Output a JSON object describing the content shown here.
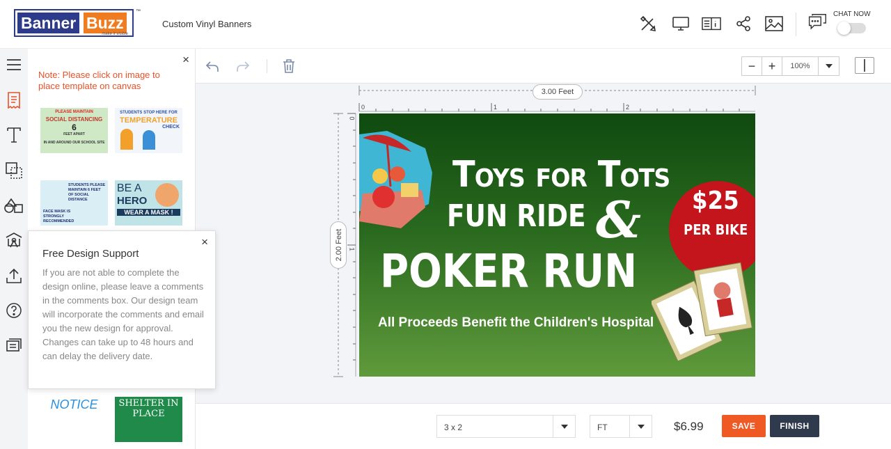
{
  "header": {
    "logo_part1": "Banner",
    "logo_part2": "Buzz",
    "logo_tag": "make it visible",
    "logo_tm": "™",
    "product_name": "Custom Vinyl Banners",
    "icons": [
      "tools-icon",
      "desktop-preview-icon",
      "info-book-icon",
      "share-icon",
      "image-icon",
      "chat-icon"
    ],
    "chat_label": "CHAT NOW"
  },
  "sidebar": {
    "icons": [
      "menu-icon",
      "templates-icon",
      "text-icon",
      "shapes-icon",
      "clipart-icon",
      "background-icon",
      "upload-icon",
      "help-icon",
      "comments-icon"
    ]
  },
  "templates_panel": {
    "close": "×",
    "note": "Note: Please click on image to place template on canvas",
    "thumbnails": [
      {
        "line1": "PLEASE MAINTAIN",
        "line2": "SOCIAL DISTANCING",
        "line3": "6",
        "line4": "FEET APART",
        "line5": "IN AND AROUND OUR SCHOOL SITE"
      },
      {
        "line1": "STUDENTS STOP HERE FOR",
        "line2": "TEMPERATURE",
        "line3": "CHECK"
      },
      {
        "line1": "STUDENTS PLEASE MAINTAIN 6 FEET OF SOCIAL DISTANCE",
        "line2": "FACE MASK IS STRONGLY RECOMMENDED"
      },
      {
        "line1": "BE A",
        "line2": "HERO",
        "line3": "WEAR A MASK !"
      },
      {
        "line1": "NOTICE"
      },
      {
        "line1": "SHELTER IN",
        "line2": "PLACE"
      }
    ]
  },
  "support_popup": {
    "title": "Free Design Support",
    "body": "If you are not able to complete the design online, please leave a comments in the comments box. Our design team will incorporate the comments and email you the new design for approval. Changes can take up to 48 hours and can delay the delivery date.",
    "close": "×"
  },
  "toolbar": {
    "zoom_minus": "−",
    "zoom_plus": "+",
    "zoom_value": "100%"
  },
  "canvas": {
    "width_label": "3.00 Feet",
    "height_label": "2.00 Feet",
    "ruler_top": [
      "0",
      "1",
      "2"
    ],
    "ruler_left": [
      "0",
      "1"
    ]
  },
  "banner": {
    "title1": "Toys for Tots",
    "title2": "FUN RIDE",
    "ampersand": "&",
    "title3": "POKER RUN",
    "subtitle": "All Proceeds Benefit the Children's Hospital",
    "price": "$25",
    "price_sub": "PER BIKE",
    "colors": {
      "bg_top": "#0f4a0f",
      "bg_bottom": "#5f9a3b",
      "circle": "#c4141c"
    }
  },
  "bottom": {
    "size_value": "3 x 2",
    "unit_value": "FT",
    "price": "$6.99",
    "save_label": "SAVE",
    "finish_label": "FINISH"
  },
  "colors": {
    "accent_orange": "#ef5a24",
    "dark_button": "#2f3b4c",
    "note_orange": "#e8512a"
  }
}
